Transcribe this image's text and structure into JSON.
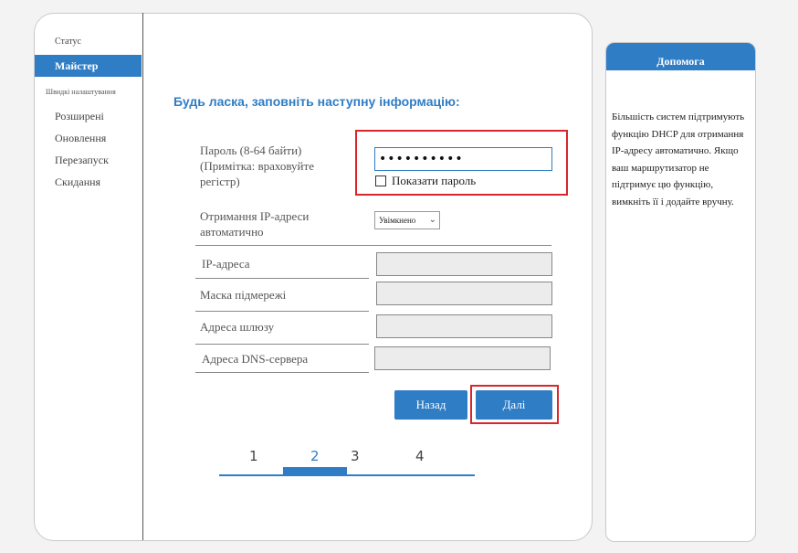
{
  "sidebar": {
    "status": "Статус",
    "wizard": "Майстер",
    "quick_settings": "Швидкі налаштування",
    "advanced": "Розширені",
    "update": "Оновлення",
    "reboot": "Перезапуск",
    "reset": "Скидання"
  },
  "form": {
    "heading": "Будь ласка, заповніть наступну інформацію:",
    "password_label_1": "Пароль (8-64 байти)",
    "password_label_2": "(Примітка: враховуйте",
    "password_label_3": "регістр)",
    "password_value": "••••••••••",
    "show_password": "Показати пароль",
    "auto_ip_label_1": "Отримання IP-адреси",
    "auto_ip_label_2": "автоматично",
    "auto_ip_value": "Увімкнено",
    "ip_address": "IP-адреса",
    "subnet_mask": "Маска підмережі",
    "gateway": "Адреса шлюзу",
    "dns": "Адреса DNS-сервера",
    "back": "Назад",
    "next": "Далі"
  },
  "steps": [
    "1",
    "2",
    "3",
    "4"
  ],
  "active_step": "2",
  "help": {
    "title": "Допомога",
    "text": "Більшість систем підтримують функцію DHCP для отримання IP-адресу автоматично. Якщо ваш маршрутизатор не підтримує цю функцію, вимкніть її і додайте вручну."
  },
  "colors": {
    "accent": "#2f7dc5",
    "highlight": "#d9262b"
  }
}
